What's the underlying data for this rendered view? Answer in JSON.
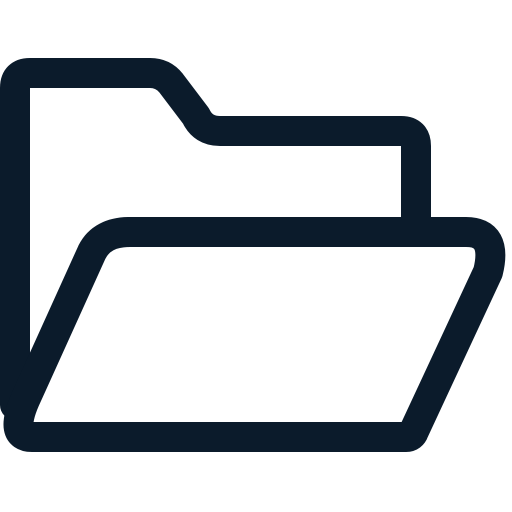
{
  "icon": {
    "name": "open-folder-icon",
    "stroke_color": "#0B1B2B",
    "background_color": "#FFFFFF"
  }
}
